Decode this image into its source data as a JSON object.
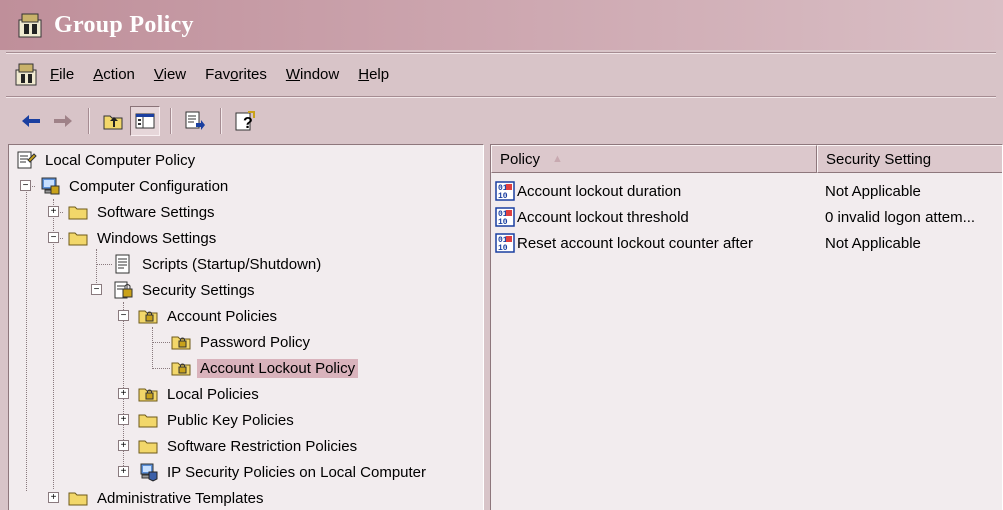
{
  "window": {
    "title": "Group Policy"
  },
  "menu": {
    "items": [
      {
        "pre": "",
        "accel": "F",
        "post": "ile"
      },
      {
        "pre": "",
        "accel": "A",
        "post": "ction"
      },
      {
        "pre": "",
        "accel": "V",
        "post": "iew"
      },
      {
        "pre": "Fav",
        "accel": "o",
        "post": "rites"
      },
      {
        "pre": "",
        "accel": "W",
        "post": "indow"
      },
      {
        "pre": "",
        "accel": "H",
        "post": "elp"
      }
    ]
  },
  "toolbar": {
    "buttons": [
      "back-icon",
      "forward-icon",
      "up-folder-icon",
      "show-hide-tree-icon",
      "export-list-icon",
      "help-icon"
    ]
  },
  "tree": {
    "items": [
      {
        "label": "Local Computer Policy",
        "icon": "policy-icon"
      },
      {
        "label": "Computer Configuration",
        "icon": "computer-icon",
        "expander": "−"
      },
      {
        "label": "Software Settings",
        "icon": "folder-icon",
        "expander": "+"
      },
      {
        "label": "Windows Settings",
        "icon": "folder-icon",
        "expander": "−"
      },
      {
        "label": "Scripts (Startup/Shutdown)",
        "icon": "script-icon"
      },
      {
        "label": "Security Settings",
        "icon": "security-settings-icon",
        "expander": "−"
      },
      {
        "label": "Account Policies",
        "icon": "secure-folder-icon",
        "expander": "−"
      },
      {
        "label": "Password Policy",
        "icon": "secure-folder-icon"
      },
      {
        "label": "Account Lockout Policy",
        "icon": "secure-folder-icon",
        "selected": true
      },
      {
        "label": "Local Policies",
        "icon": "secure-folder-icon",
        "expander": "+"
      },
      {
        "label": "Public Key Policies",
        "icon": "folder-icon",
        "expander": "+"
      },
      {
        "label": "Software Restriction Policies",
        "icon": "folder-icon",
        "expander": "+"
      },
      {
        "label": "IP Security Policies on Local Computer",
        "icon": "ip-security-icon",
        "expander": "+"
      },
      {
        "label": "Administrative Templates",
        "icon": "folder-icon",
        "expander": "+"
      }
    ]
  },
  "list": {
    "columns": [
      "Policy",
      "Security Setting"
    ],
    "sort_indicator": "▲",
    "rows": [
      {
        "policy": "Account lockout duration",
        "setting": "Not Applicable"
      },
      {
        "policy": "Account lockout threshold",
        "setting": "0 invalid logon attem..."
      },
      {
        "policy": "Reset account lockout counter after",
        "setting": "Not Applicable"
      }
    ]
  },
  "colors": {
    "titlebar": "#bf8f9a",
    "window_bg": "#d8c4c8",
    "pane_bg": "#f2ecee",
    "selection": "#d9b3bc"
  }
}
